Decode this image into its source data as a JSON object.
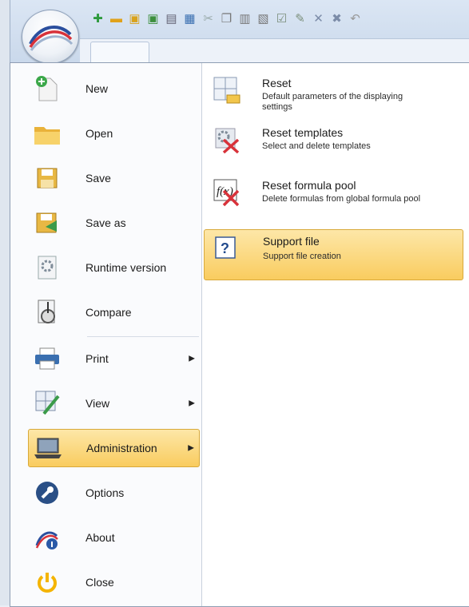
{
  "quick_access_icons": [
    "new-doc-icon",
    "open-folder-icon",
    "save-icon",
    "save-green-icon",
    "auto-icon",
    "print-icon",
    "cut-icon",
    "copy-icon",
    "paste-icon",
    "paste-special-icon",
    "check-icon",
    "edit-icon",
    "delete-icon",
    "cross-icon",
    "undo-icon"
  ],
  "menu": {
    "items": [
      {
        "label": "New",
        "icon": "new-document-icon"
      },
      {
        "label": "Open",
        "icon": "folder-icon"
      },
      {
        "label": "Save",
        "icon": "floppy-icon"
      },
      {
        "label": "Save as",
        "icon": "save-as-icon"
      },
      {
        "label": "Runtime version",
        "icon": "runtime-icon"
      },
      {
        "label": "Compare",
        "icon": "compare-icon"
      },
      {
        "label": "Print",
        "icon": "printer-icon",
        "has_submenu": true
      },
      {
        "label": "View",
        "icon": "view-icon",
        "has_submenu": true
      },
      {
        "label": "Administration",
        "icon": "laptop-icon",
        "has_submenu": true,
        "active": true
      },
      {
        "label": "Options",
        "icon": "wrench-icon"
      },
      {
        "label": "About",
        "icon": "info-icon"
      },
      {
        "label": "Close",
        "icon": "power-icon"
      }
    ],
    "submenu_arrow": "▶"
  },
  "submenu": {
    "items": [
      {
        "title": "Reset",
        "desc": "Default parameters of the displaying settings",
        "icon": "reset-layout-icon"
      },
      {
        "title": "Reset templates",
        "desc": "Select and delete templates",
        "icon": "reset-templates-icon"
      },
      {
        "title": "Reset formula pool",
        "desc": "Delete formulas from global formula pool",
        "icon": "formula-delete-icon"
      },
      {
        "title": "Support file",
        "desc": "Support file creation",
        "icon": "help-icon",
        "active": true
      }
    ]
  },
  "colors": {
    "accent": "#f9cc5f",
    "accent_border": "#d8a93a",
    "frame": "#8e9db3"
  }
}
